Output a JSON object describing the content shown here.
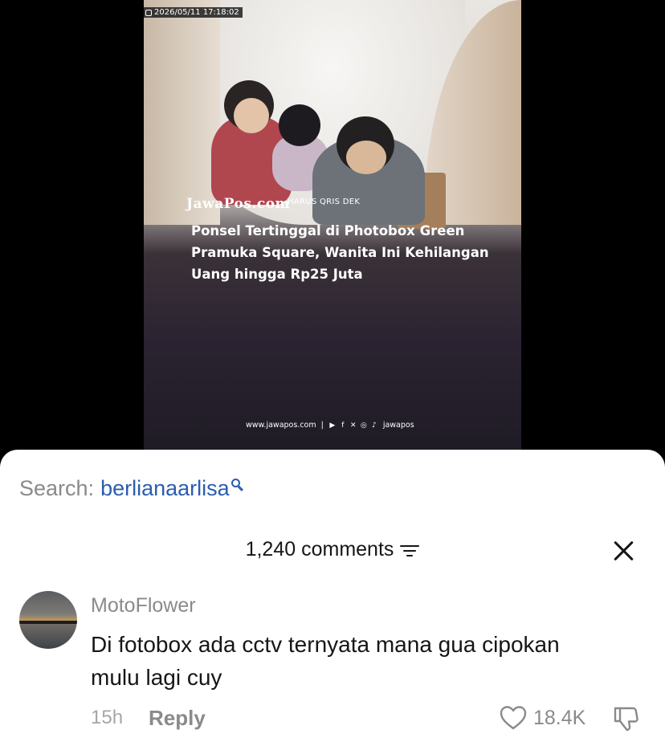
{
  "video": {
    "timestamp": "2026/05/11 17:18:02",
    "brand": "JawaPos.com",
    "overlay_caption": "HARUS QRIS DEK",
    "headline": "Ponsel Tertinggal di Photobox Green Pramuka Square, Wanita Ini Kehilangan Uang hingga Rp25 Juta",
    "footer": {
      "website": "www.jawapos.com",
      "separator": "|",
      "social_icons": [
        "youtube-icon",
        "facebook-icon",
        "x-icon",
        "instagram-icon",
        "tiktok-icon"
      ],
      "handle": "jawapos"
    }
  },
  "search": {
    "label": "Search:",
    "term": "berlianaarlisa"
  },
  "comments_header": {
    "count_label": "1,240 comments"
  },
  "comment": {
    "username": "MotoFlower",
    "text": "Di fotobox ada cctv ternyata mana gua cipokan mulu lagi cuy",
    "time": "15h",
    "reply_label": "Reply",
    "likes": "18.4K"
  },
  "colors": {
    "search_term": "#2a5db0",
    "muted_text": "#8a8a8a",
    "primary_text": "#161616"
  }
}
